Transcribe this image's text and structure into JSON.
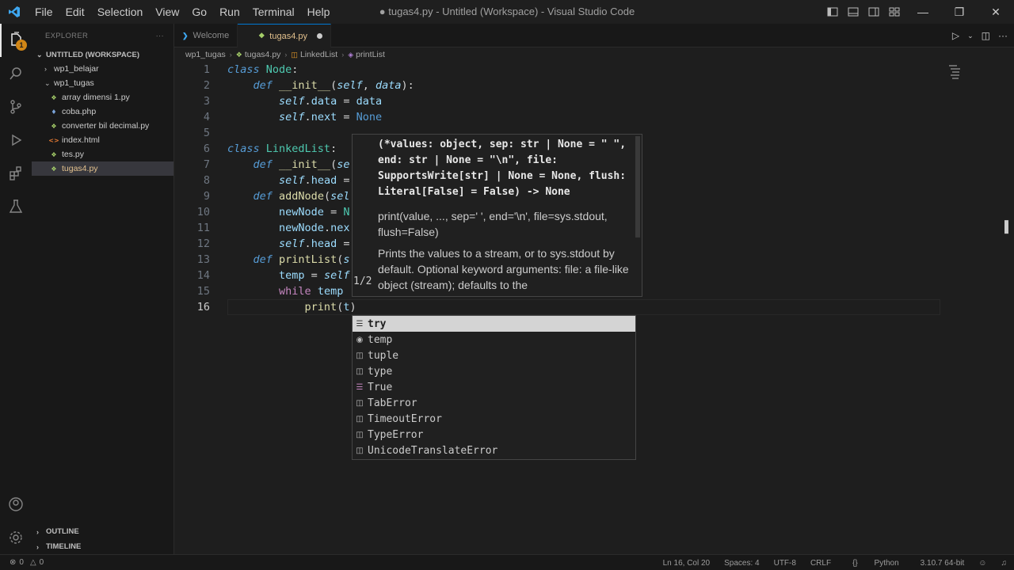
{
  "app": {
    "window_title": "● tugas4.py - Untitled (Workspace) - Visual Studio Code",
    "menu": [
      "File",
      "Edit",
      "Selection",
      "View",
      "Go",
      "Run",
      "Terminal",
      "Help"
    ]
  },
  "sidebar": {
    "header": "EXPLORER",
    "header_more": "···",
    "workspace": "UNTITLED (WORKSPACE)",
    "folders": [
      {
        "name": "wp1_belajar",
        "expanded": false
      },
      {
        "name": "wp1_tugas",
        "expanded": true
      }
    ],
    "files": [
      {
        "name": "array dimensi 1.py",
        "icon": "python-icon",
        "selected": false
      },
      {
        "name": "coba.php",
        "icon": "php-icon",
        "selected": false
      },
      {
        "name": "converter bil decimal.py",
        "icon": "python-icon",
        "selected": false
      },
      {
        "name": "index.html",
        "icon": "html-icon",
        "selected": false
      },
      {
        "name": "tes.py",
        "icon": "python-icon",
        "selected": false
      },
      {
        "name": "tugas4.py",
        "icon": "python-icon",
        "selected": true
      }
    ],
    "outline": "OUTLINE",
    "timeline": "TIMELINE"
  },
  "tabs": [
    {
      "label": "Welcome",
      "icon": "vscode-icon",
      "active": false
    },
    {
      "label": "tugas4.py",
      "icon": "python-icon",
      "active": true,
      "dirty": true
    }
  ],
  "breadcrumb": [
    "wp1_tugas",
    "tugas4.py",
    "LinkedList",
    "printList"
  ],
  "editor": {
    "line_numbers": [
      "1",
      "2",
      "3",
      "4",
      "5",
      "6",
      "7",
      "8",
      "9",
      "10",
      "11",
      "12",
      "13",
      "14",
      "15",
      "16"
    ],
    "current_line": 16
  },
  "parameter_hint": {
    "signature": "(*values: object, sep: str | None = \" \", end: str | None = \"\\n\", file: SupportsWrite[str] | None = None, flush: Literal[False] = False) -> None",
    "doc_line1": "print(value, ..., sep=' ', end='\\n', file=sys.stdout, flush=False)",
    "doc_line2": "Prints the values to a stream, or to sys.stdout by default. Optional keyword arguments: file: a file-like object (stream); defaults to the",
    "counter": "1/2"
  },
  "suggestions": [
    {
      "label": "try",
      "icon": "snippet-icon",
      "selected": true
    },
    {
      "label": "temp",
      "icon": "variable-icon",
      "selected": false
    },
    {
      "label": "tuple",
      "icon": "class-icon",
      "selected": false
    },
    {
      "label": "type",
      "icon": "class-icon",
      "selected": false
    },
    {
      "label": "True",
      "icon": "keyword-icon",
      "selected": false
    },
    {
      "label": "TabError",
      "icon": "class-icon",
      "selected": false
    },
    {
      "label": "TimeoutError",
      "icon": "class-icon",
      "selected": false
    },
    {
      "label": "TypeError",
      "icon": "class-icon",
      "selected": false
    },
    {
      "label": "UnicodeTranslateError",
      "icon": "class-icon",
      "selected": false
    }
  ],
  "statusbar": {
    "errors": "0",
    "warnings": "0",
    "position": "Ln 16, Col 20",
    "spaces": "Spaces: 4",
    "encoding": "UTF-8",
    "eol": "CRLF",
    "language": "Python",
    "interpreter": "3.10.7 64-bit"
  },
  "colors": {
    "accent": "#0078d4",
    "badge": "#d18616"
  }
}
